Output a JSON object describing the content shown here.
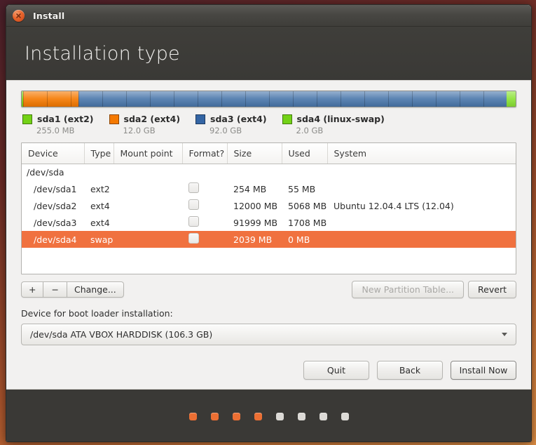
{
  "window": {
    "title": "Install",
    "close_icon": "close-icon"
  },
  "header": {
    "page_title": "Installation type"
  },
  "partition_bar": {
    "segments": [
      {
        "name": "sda1",
        "color": "#73d216",
        "percent": 0.24
      },
      {
        "name": "sda2",
        "color": "#f57900",
        "percent": 11.3
      },
      {
        "name": "sda3",
        "color": "#4a77ab",
        "percent": 86.56
      },
      {
        "name": "sda4",
        "color": "#8ae234",
        "percent": 1.9
      }
    ]
  },
  "legend": [
    {
      "label": "sda1 (ext2)",
      "size": "255.0 MB",
      "color": "#73d216"
    },
    {
      "label": "sda2 (ext4)",
      "size": "12.0 GB",
      "color": "#f57900"
    },
    {
      "label": "sda3 (ext4)",
      "size": "92.0 GB",
      "color": "#3465a4"
    },
    {
      "label": "sda4 (linux-swap)",
      "size": "2.0 GB",
      "color": "#73d216"
    }
  ],
  "table": {
    "columns": [
      "Device",
      "Type",
      "Mount point",
      "Format?",
      "Size",
      "Used",
      "System"
    ],
    "rows": [
      {
        "device": "/dev/sda",
        "type": "",
        "mount": "",
        "format": false,
        "size": "",
        "used": "",
        "system": "",
        "is_disk": true,
        "selected": false
      },
      {
        "device": "/dev/sda1",
        "type": "ext2",
        "mount": "",
        "format": false,
        "size": "254 MB",
        "used": "55 MB",
        "system": "",
        "is_disk": false,
        "selected": false
      },
      {
        "device": "/dev/sda2",
        "type": "ext4",
        "mount": "",
        "format": false,
        "size": "12000 MB",
        "used": "5068 MB",
        "system": "Ubuntu 12.04.4 LTS (12.04)",
        "is_disk": false,
        "selected": false
      },
      {
        "device": "/dev/sda3",
        "type": "ext4",
        "mount": "",
        "format": false,
        "size": "91999 MB",
        "used": "1708 MB",
        "system": "",
        "is_disk": false,
        "selected": false
      },
      {
        "device": "/dev/sda4",
        "type": "swap",
        "mount": "",
        "format": false,
        "size": "2039 MB",
        "used": "0 MB",
        "system": "",
        "is_disk": false,
        "selected": true
      }
    ]
  },
  "toolbar": {
    "add_label": "+",
    "remove_label": "−",
    "change_label": "Change...",
    "new_partition_table_label": "New Partition Table...",
    "new_partition_table_disabled": true,
    "revert_label": "Revert"
  },
  "boot_loader": {
    "label": "Device for boot loader installation:",
    "selected": "/dev/sda   ATA VBOX HARDDISK (106.3 GB)"
  },
  "actions": {
    "quit_label": "Quit",
    "back_label": "Back",
    "install_label": "Install Now"
  },
  "progress_dots": {
    "total": 8,
    "completed": 4
  },
  "colors": {
    "accent_orange": "#f0713f",
    "titlebar_dark": "#3f3e3a",
    "footer_dark": "#3a3936",
    "selection": "#f0713f"
  }
}
